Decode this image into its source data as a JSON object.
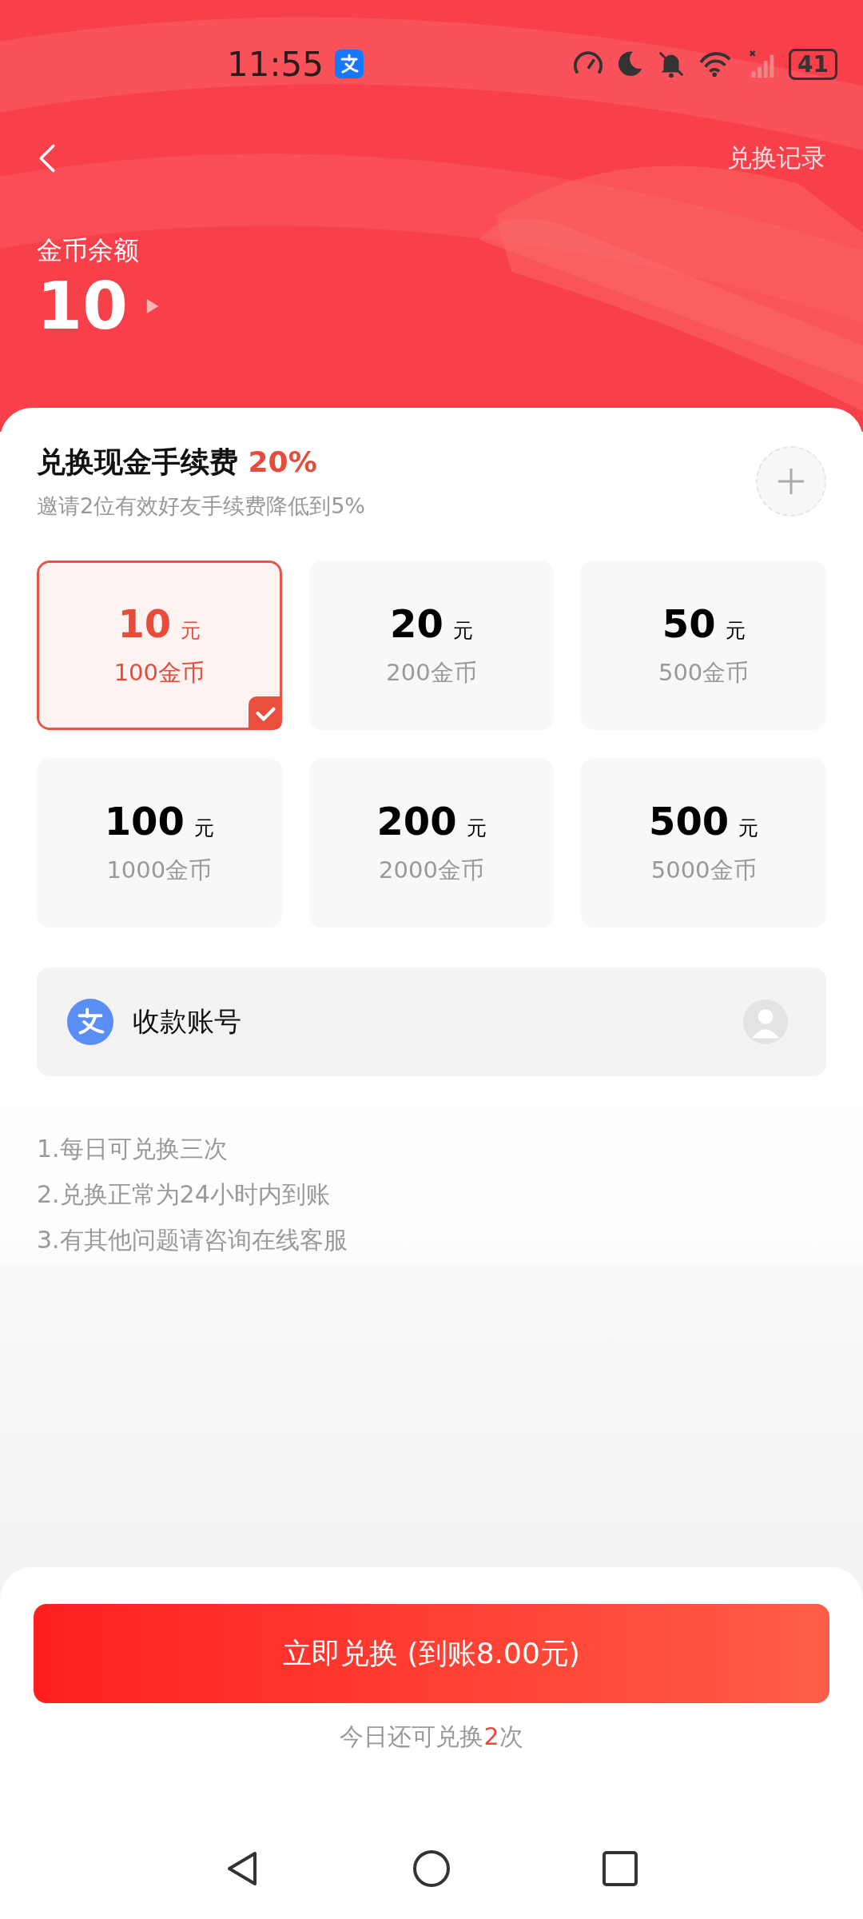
{
  "status_bar": {
    "time": "11:55",
    "battery": "41"
  },
  "header": {
    "history_link": "兑换记录",
    "balance_label": "金币余额",
    "balance": "10"
  },
  "fee": {
    "title": "兑换现金手续费",
    "rate": "20%",
    "subtitle": "邀请2位有效好友手续费降低到5%"
  },
  "options": [
    {
      "amount": "10",
      "unit": "元",
      "coins": "100金币",
      "selected": true
    },
    {
      "amount": "20",
      "unit": "元",
      "coins": "200金币",
      "selected": false
    },
    {
      "amount": "50",
      "unit": "元",
      "coins": "500金币",
      "selected": false
    },
    {
      "amount": "100",
      "unit": "元",
      "coins": "1000金币",
      "selected": false
    },
    {
      "amount": "200",
      "unit": "元",
      "coins": "2000金币",
      "selected": false
    },
    {
      "amount": "500",
      "unit": "元",
      "coins": "5000金币",
      "selected": false
    }
  ],
  "account": {
    "label": "收款账号"
  },
  "notes": [
    "1.每日可兑换三次",
    "2.兑换正常为24小时内到账",
    "3.有其他问题请咨询在线客服"
  ],
  "submit": {
    "label": "立即兑换 (到账8.00元)"
  },
  "remaining": "今日还可兑换**2**次"
}
